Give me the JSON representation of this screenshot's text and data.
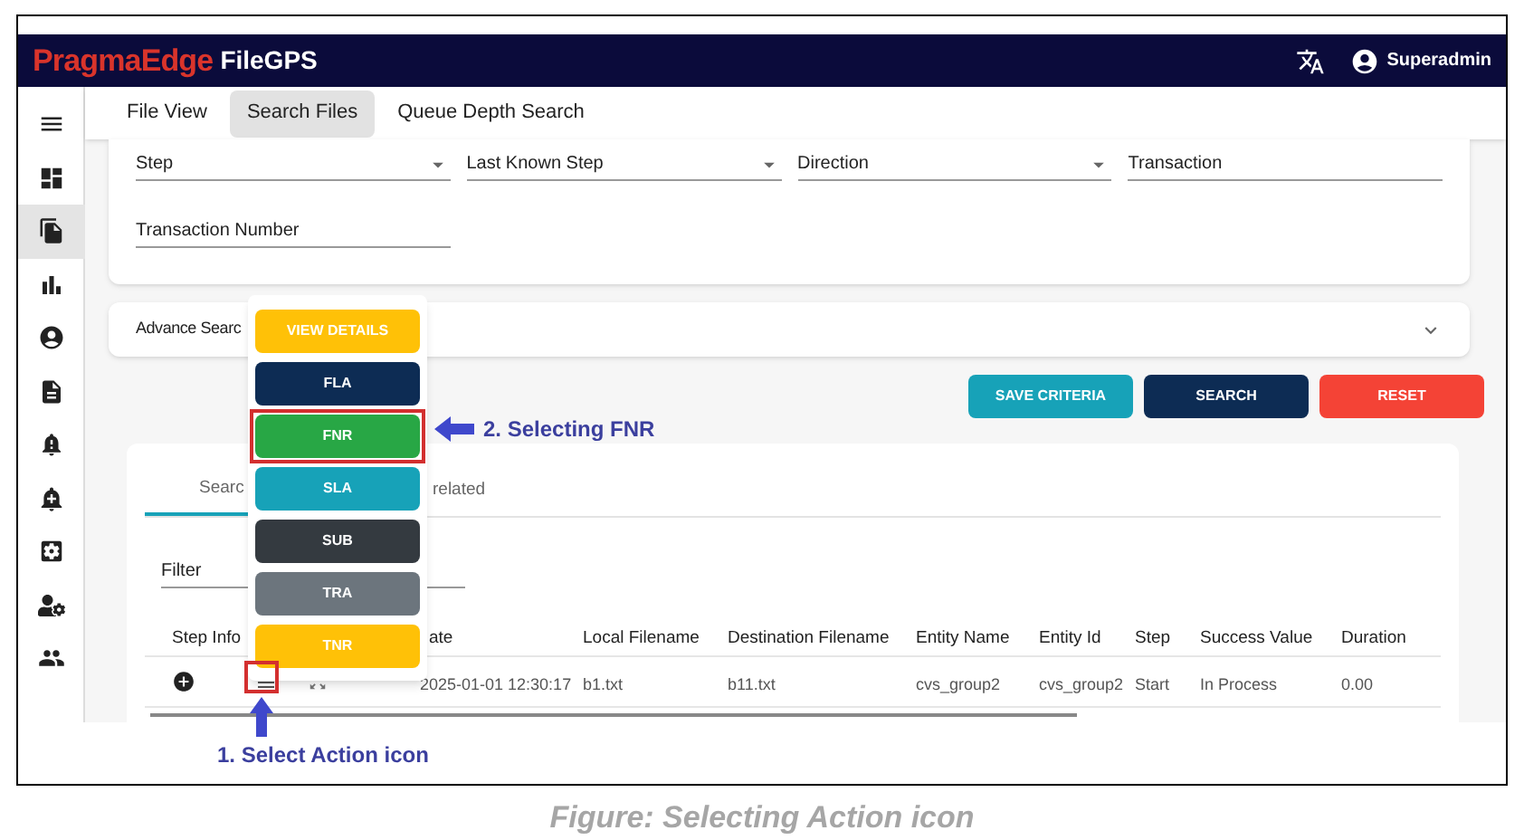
{
  "header": {
    "logo_brand": "PragmaEdge",
    "logo_product": "FileGPS",
    "user": "Superadmin"
  },
  "sidebar": {
    "items": [
      {
        "selected": false
      },
      {
        "selected": false
      },
      {
        "selected": true
      },
      {
        "selected": false
      },
      {
        "selected": false
      },
      {
        "selected": false
      },
      {
        "selected": false
      },
      {
        "selected": false
      },
      {
        "selected": false
      },
      {
        "selected": false
      },
      {
        "selected": false
      }
    ]
  },
  "tabs": [
    {
      "label": "File View",
      "selected": false
    },
    {
      "label": "Search Files",
      "selected": true
    },
    {
      "label": "Queue Depth Search",
      "selected": false
    }
  ],
  "form": {
    "fields": [
      {
        "label": "Step",
        "kind": "select"
      },
      {
        "label": "Last Known Step",
        "kind": "select"
      },
      {
        "label": "Direction",
        "kind": "select"
      },
      {
        "label": "Transaction",
        "kind": "text"
      },
      {
        "label": "Transaction Number",
        "kind": "text"
      }
    ]
  },
  "advance_search": {
    "label": "Advance Searc",
    "expanded": false
  },
  "buttons": [
    {
      "label": "SAVE CRITERIA",
      "color": "#17a2b8"
    },
    {
      "label": "SEARCH",
      "color": "#0d2c54"
    },
    {
      "label": "RESET",
      "color": "#f44336"
    }
  ],
  "results": {
    "tabs": [
      {
        "label": "Searc",
        "selected": true
      },
      {
        "label": "related",
        "selected": false
      }
    ],
    "filter": {
      "placeholder": "Filter"
    },
    "table": {
      "columns": [
        "Step Info",
        "ate",
        "Local Filename",
        "Destination Filename",
        "Entity Name",
        "Entity Id",
        "Step",
        "Success Value",
        "Duration"
      ],
      "rows": [
        {
          "date": "2025-01-01 12:30:17",
          "local_filename": "b1.txt",
          "destination_filename": "b11.txt",
          "entity_name": "cvs_group2",
          "entity_id": "cvs_group2",
          "step": "Start",
          "success_value": "In Process",
          "duration": "0.00"
        }
      ]
    }
  },
  "action_menu": {
    "items": [
      {
        "label": "VIEW DETAILS",
        "color": "#ffc107",
        "highlighted": false
      },
      {
        "label": "FLA",
        "color": "#0d2c54",
        "highlighted": false
      },
      {
        "label": "FNR",
        "color": "#28a745",
        "highlighted": true
      },
      {
        "label": "SLA",
        "color": "#17a2b8",
        "highlighted": false
      },
      {
        "label": "SUB",
        "color": "#343a40",
        "highlighted": false
      },
      {
        "label": "TRA",
        "color": "#6c757d",
        "highlighted": false
      },
      {
        "label": "TNR",
        "color": "#ffc107",
        "highlighted": false
      }
    ]
  },
  "annotations": [
    {
      "text": "2. Selecting FNR"
    },
    {
      "text": "1. Select Action icon"
    }
  ],
  "caption": "Figure: Selecting Action icon"
}
